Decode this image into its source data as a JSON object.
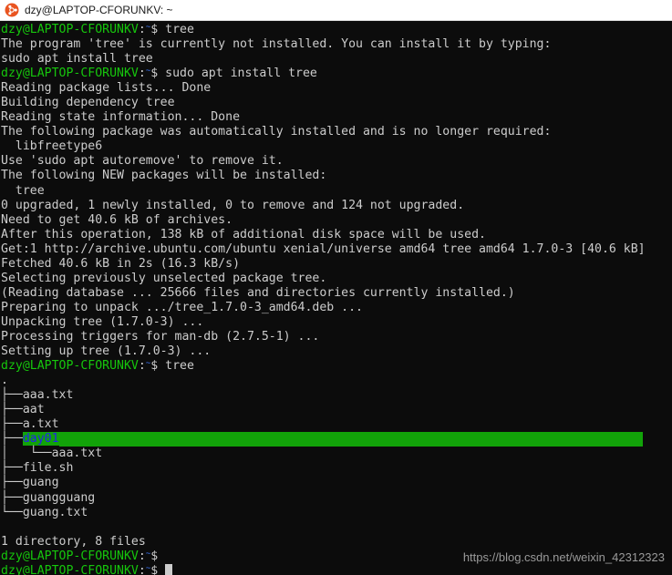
{
  "titlebar": {
    "icon": "ubuntu-logo-icon",
    "title": "dzy@LAPTOP-CFORUNKV: ~"
  },
  "colors": {
    "background": "#0c0c0c",
    "foreground": "#cccccc",
    "prompt_user_host": "#16c60c",
    "prompt_path": "#3b78ff",
    "highlight_bg": "#12a309",
    "highlight_fg": "#2222ee",
    "titlebar_bg": "#ffffff",
    "watermark": "#9a9a9a"
  },
  "prompt": {
    "user_host": "dzy@LAPTOP-CFORUNKV",
    "colon": ":",
    "path": "~",
    "sigil": "$"
  },
  "commands": {
    "cmd1": "tree",
    "cmd2": "sudo apt install tree",
    "cmd3": "tree"
  },
  "output": {
    "l01": "The program 'tree' is currently not installed. You can install it by typing:",
    "l02": "sudo apt install tree",
    "l03": "Reading package lists... Done",
    "l04": "Building dependency tree",
    "l05": "Reading state information... Done",
    "l06": "The following package was automatically installed and is no longer required:",
    "l07": "  libfreetype6",
    "l08": "Use 'sudo apt autoremove' to remove it.",
    "l09": "The following NEW packages will be installed:",
    "l10": "  tree",
    "l11": "0 upgraded, 1 newly installed, 0 to remove and 124 not upgraded.",
    "l12": "Need to get 40.6 kB of archives.",
    "l13": "After this operation, 138 kB of additional disk space will be used.",
    "l14": "Get:1 http://archive.ubuntu.com/ubuntu xenial/universe amd64 tree amd64 1.7.0-3 [40.6 kB]",
    "l15": "Fetched 40.6 kB in 2s (16.3 kB/s)",
    "l16": "Selecting previously unselected package tree.",
    "l17": "(Reading database ... 25666 files and directories currently installed.)",
    "l18": "Preparing to unpack .../tree_1.7.0-3_amd64.deb ...",
    "l19": "Unpacking tree (1.7.0-3) ...",
    "l20": "Processing triggers for man-db (2.7.5-1) ...",
    "l21": "Setting up tree (1.7.0-3) ..."
  },
  "tree_output": {
    "root": ".",
    "entries": [
      {
        "prefix": "├──",
        "name": "aaa.txt",
        "type": "file"
      },
      {
        "prefix": "├──",
        "name": "aat",
        "type": "file"
      },
      {
        "prefix": "├──",
        "name": "a.txt",
        "type": "file"
      },
      {
        "prefix": "├──",
        "name": "day01",
        "type": "dir"
      },
      {
        "prefix": "│   └──",
        "name": "aaa.txt",
        "type": "file"
      },
      {
        "prefix": "├──",
        "name": "file.sh",
        "type": "file"
      },
      {
        "prefix": "├──",
        "name": "guang",
        "type": "file"
      },
      {
        "prefix": "├──",
        "name": "guangguang",
        "type": "file"
      },
      {
        "prefix": "└──",
        "name": "guang.txt",
        "type": "file"
      }
    ],
    "rows": {
      "r1": "├──aaa.txt",
      "r2": "├──aat",
      "r3": "├──a.txt",
      "r4_prefix": "├──",
      "r4_name": "day01",
      "r5": "│   └──aaa.txt",
      "r6": "├──file.sh",
      "r7": "├──guang",
      "r8": "├──guangguang",
      "r9": "└──guang.txt"
    },
    "summary": "1 directory, 8 files"
  },
  "watermark": {
    "text": "https://blog.csdn.net/weixin_42312323"
  }
}
